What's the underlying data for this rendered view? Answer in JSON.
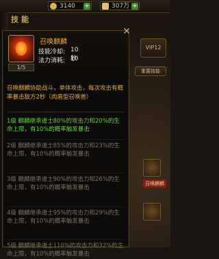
{
  "topbar": {
    "resource1": "3140",
    "resource2": "307万",
    "plus_symbol": "+"
  },
  "background": {
    "title": "技能",
    "vip_label": "VIP12",
    "reset_label": "重置技能",
    "red_label": "召唤麒麟"
  },
  "skill": {
    "name": "召唤麒麟",
    "level": "1/5",
    "cooldown_label": "技能冷却:",
    "cooldown_value": "10秒",
    "mana_label": "法力消耗:",
    "mana_value": "10",
    "description": "召唤麒麟协助战斗，单体攻击，每次攻击有概率暴击敌方2秒（肉盾型召唤兽）"
  },
  "levels": [
    {
      "text": "1级 麒麟继承道士80%的攻击力和20%的生命上限，有10%的概率触发暴击",
      "active": true
    },
    {
      "text": "2级 麒麟继承道士85%的攻击力和23%的生命上限，有10%的概率触发暴击",
      "active": false
    },
    {
      "text": "3级 麒麟继承道士90%的攻击力和26%的生命上限，有10%的概率触发暴击",
      "active": false
    },
    {
      "text": "4级 麒麟继承道士95%的攻击力和29%的生命上限，有10%的概率触发暴击",
      "active": false
    },
    {
      "text": "5级 麒麟继承道士110%的攻击力和32%的生命上限，有10%的概率触发暴击",
      "active": false
    }
  ],
  "colors": {
    "active_level": "#5fd23b",
    "inactive_level": "#7a7364",
    "skill_name": "#e8a23a",
    "description": "#e0a848"
  },
  "icons": {
    "close": "close-icon",
    "skill": "qilin-skill-icon"
  }
}
